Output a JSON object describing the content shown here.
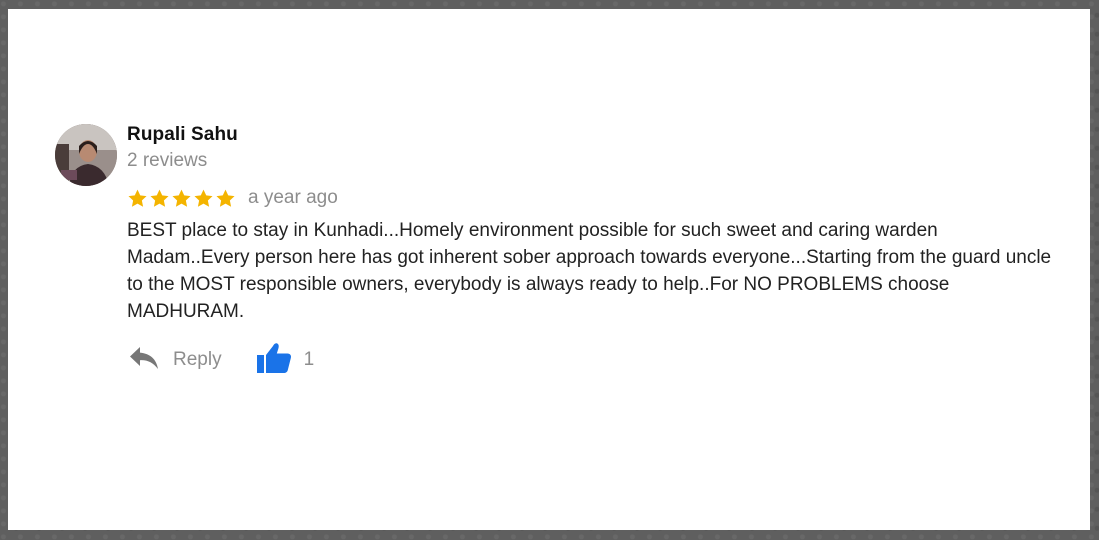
{
  "review": {
    "author_name": "Rupali Sahu",
    "review_count": "2 reviews",
    "rating": 5,
    "rating_max": 5,
    "time": "a year ago",
    "text": "BEST place to stay in Kunhadi...Homely environment possible for such sweet and caring warden Madam..Every person here has got inherent sober approach towards everyone...Starting from the guard uncle to the MOST responsible owners, everybody is always ready to help..For NO PROBLEMS choose MADHURAM.",
    "actions": {
      "reply_label": "Reply",
      "like_count": "1"
    }
  },
  "icons": {
    "avatar": "user-avatar-photo",
    "star": "star-icon",
    "reply": "reply-icon",
    "like": "thumbs-up-icon"
  },
  "colors": {
    "star": "#f4b400",
    "like": "#1a73e8",
    "muted_text": "#8d8d8d",
    "body_text": "#222222",
    "name_text": "#111111"
  }
}
